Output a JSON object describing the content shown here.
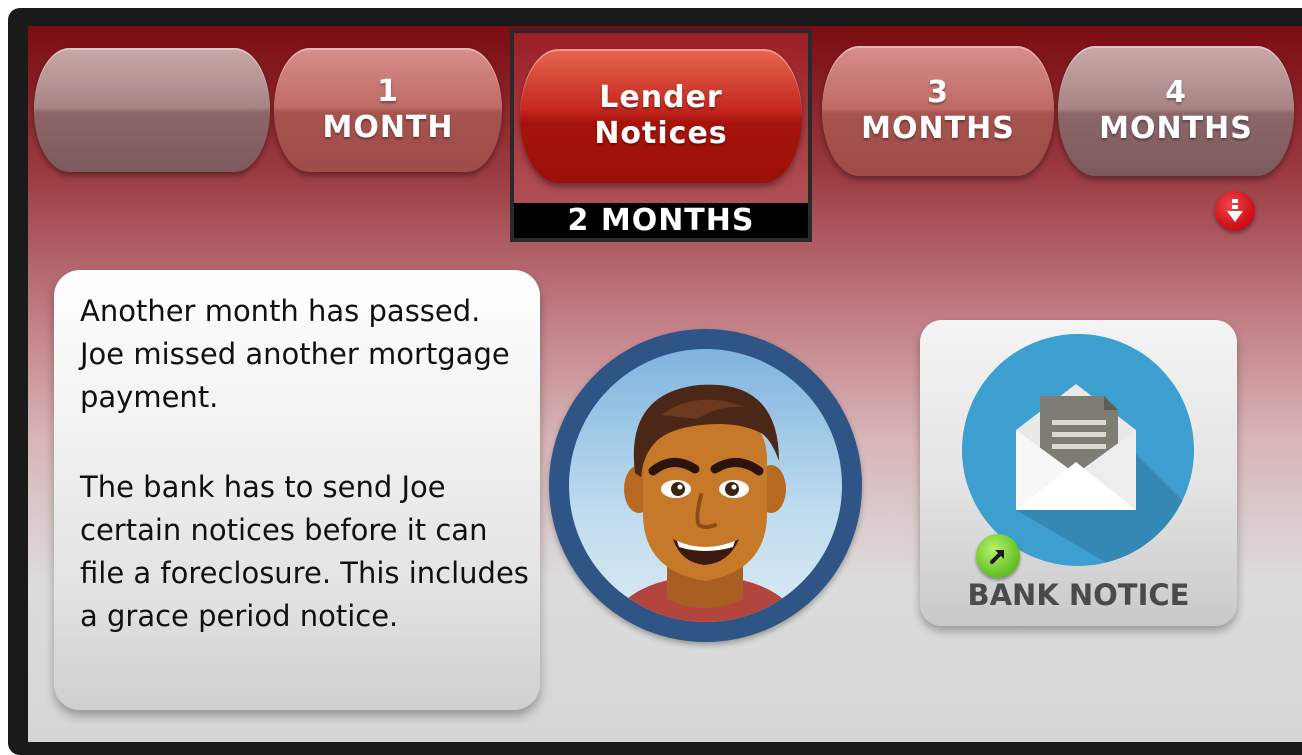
{
  "tabs": [
    {
      "line1": "",
      "line2": ""
    },
    {
      "line1": "1",
      "line2": "MONTH"
    },
    {
      "line1": "Lender",
      "line2": "Notices"
    },
    {
      "line1": "3",
      "line2": "MONTHS"
    },
    {
      "line1": "4",
      "line2": "MONTHS"
    }
  ],
  "active_step_label": "2 MONTHS",
  "story": {
    "paragraph1": "Another month has passed. Joe missed another mortgage payment.",
    "paragraph2": "The bank has to send Joe certain notices before it can file a foreclosure.  This includes a grace period notice."
  },
  "notice_card": {
    "label": "BANK NOTICE",
    "icon": "envelope-icon"
  },
  "icons": {
    "scroll_down": "arrow-down-icon",
    "open": "arrow-up-right-icon",
    "character": "joe-avatar"
  },
  "colors": {
    "active_tab": "#b31a12",
    "tab": "#b86660",
    "avatar_ring": "#2f5486",
    "notice_circle": "#3d9fd0",
    "go_button": "#6cc62b",
    "down_button": "#d3121b"
  }
}
